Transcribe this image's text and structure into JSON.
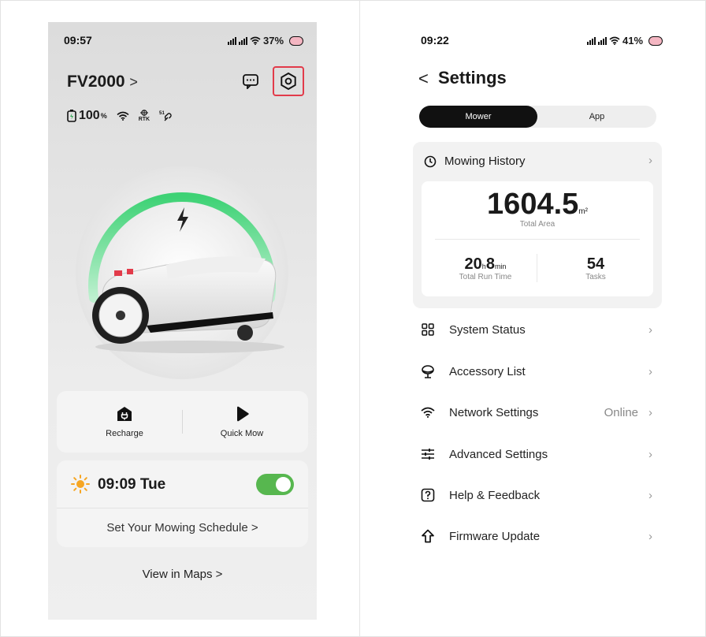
{
  "left_screen": {
    "status_time": "09:57",
    "battery_status": "37%",
    "device_name": "FV2000",
    "device_chevron": ">",
    "battery_level": "100",
    "battery_unit": "%",
    "rtk_label": "RTK",
    "recharge_label": "Recharge",
    "quick_mow_label": "Quick Mow",
    "schedule_time": "09:09 Tue",
    "schedule_link": "Set Your Mowing Schedule >",
    "view_maps": "View in Maps >",
    "toggle_on": true,
    "colors": {
      "toggle": "#57b74f",
      "highlight": "#e23b4a",
      "charge_arc": "#4fd67e"
    }
  },
  "right_screen": {
    "status_time": "09:22",
    "battery_status": "41%",
    "back": "<",
    "title": "Settings",
    "tabs": [
      "Mower",
      "App"
    ],
    "active_tab": "Mower",
    "history": {
      "title": "Mowing History",
      "area_value": "1604.5",
      "area_unit": "m²",
      "area_label": "Total Area",
      "run_hours": "20",
      "run_hours_unit": "h",
      "run_minutes": "8",
      "run_minutes_unit": "min",
      "run_label": "Total Run Time",
      "tasks_value": "54",
      "tasks_label": "Tasks"
    },
    "menu": [
      {
        "label": "System Status",
        "value": "",
        "icon": "grid-icon"
      },
      {
        "label": "Accessory List",
        "value": "",
        "icon": "accessory-icon"
      },
      {
        "label": "Network Settings",
        "value": "Online",
        "icon": "wifi-icon"
      },
      {
        "label": "Advanced Settings",
        "value": "",
        "icon": "sliders-icon"
      },
      {
        "label": "Help & Feedback",
        "value": "",
        "icon": "help-icon"
      },
      {
        "label": "Firmware Update",
        "value": "",
        "icon": "upload-arrow-icon"
      }
    ]
  }
}
